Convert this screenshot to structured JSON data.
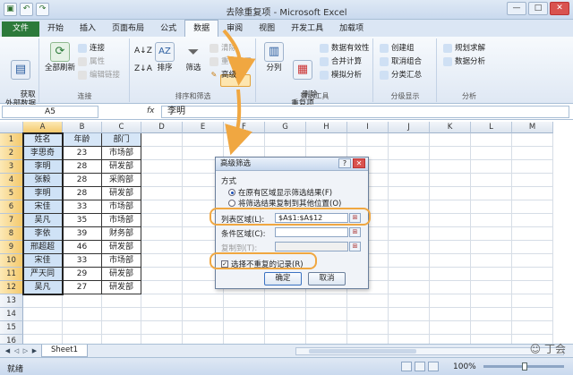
{
  "app": {
    "title": "去除重复项 - Microsoft Excel",
    "qat_icons": [
      "save-icon",
      "undo-icon",
      "redo-icon"
    ],
    "window_buttons": [
      "—",
      "□",
      "✕"
    ]
  },
  "tabs": [
    "文件",
    "开始",
    "插入",
    "页面布局",
    "公式",
    "数据",
    "审阅",
    "视图",
    "开发工具",
    "加载项"
  ],
  "ribbon": {
    "get_external": "获取\n外部数据",
    "refresh_all": "全部刷新",
    "connections": "连接",
    "properties": "属性",
    "edit_links": "编辑链接",
    "group_connections": "连接",
    "sort": "排序",
    "filter": "筛选",
    "clear": "清除",
    "reapply": "重新应用",
    "advanced": "高级",
    "group_sort_filter": "排序和筛选",
    "text_to_columns": "分列",
    "remove_duplicates": "删除\n重复项",
    "data_validation": "数据有效性",
    "consolidate": "合并计算",
    "what_if": "模拟分析",
    "group_data_tools": "数据工具",
    "group": "创建组",
    "ungroup": "取消组合",
    "subtotal": "分类汇总",
    "group_outline": "分级显示",
    "solver": "规划求解",
    "data_analysis": "数据分析",
    "group_analysis": "分析"
  },
  "formula_bar": {
    "name_box": "A5",
    "fx": "fx",
    "value": "李明"
  },
  "columns": [
    "A",
    "B",
    "C",
    "D",
    "E",
    "F",
    "G",
    "H",
    "I",
    "J",
    "K",
    "L",
    "M"
  ],
  "rows": [
    "1",
    "2",
    "3",
    "4",
    "5",
    "6",
    "7",
    "8",
    "9",
    "10",
    "11",
    "12",
    "13",
    "14",
    "15",
    "16"
  ],
  "table": {
    "headers": [
      "姓名",
      "年龄",
      "部门"
    ],
    "rows": [
      [
        "李思奇",
        "23",
        "市场部"
      ],
      [
        "李明",
        "28",
        "研发部"
      ],
      [
        "张毅",
        "28",
        "采购部"
      ],
      [
        "李明",
        "28",
        "研发部"
      ],
      [
        "宋佳",
        "33",
        "市场部"
      ],
      [
        "吴凡",
        "35",
        "市场部"
      ],
      [
        "李依",
        "39",
        "财务部"
      ],
      [
        "邢超超",
        "46",
        "研发部"
      ],
      [
        "宋佳",
        "33",
        "市场部"
      ],
      [
        "严天同",
        "29",
        "研发部"
      ],
      [
        "吴凡",
        "27",
        "研发部"
      ]
    ]
  },
  "dialog": {
    "title": "高级筛选",
    "help": "?",
    "close": "✕",
    "method_label": "方式",
    "option1": "在原有区域显示筛选结果(F)",
    "option2": "将筛选结果复制到其他位置(O)",
    "list_range_label": "列表区域(L):",
    "list_range_value": "$A$1:$A$12",
    "criteria_label": "条件区域(C):",
    "criteria_value": "",
    "copy_to_label": "复制到(T):",
    "copy_to_value": "",
    "unique_label": "选择不重复的记录(R)",
    "unique_checked": true,
    "ok": "确定",
    "cancel": "取消"
  },
  "sheet_tab": "Sheet1",
  "status": {
    "ready": "就绪",
    "zoom": "100%"
  },
  "watermark": "丁会",
  "colors": {
    "accent_orange": "#f0a741",
    "file_tab_green": "#2c7a3a",
    "selected_header": "#f4c96c",
    "cell_blue": "#cfe2f6"
  }
}
